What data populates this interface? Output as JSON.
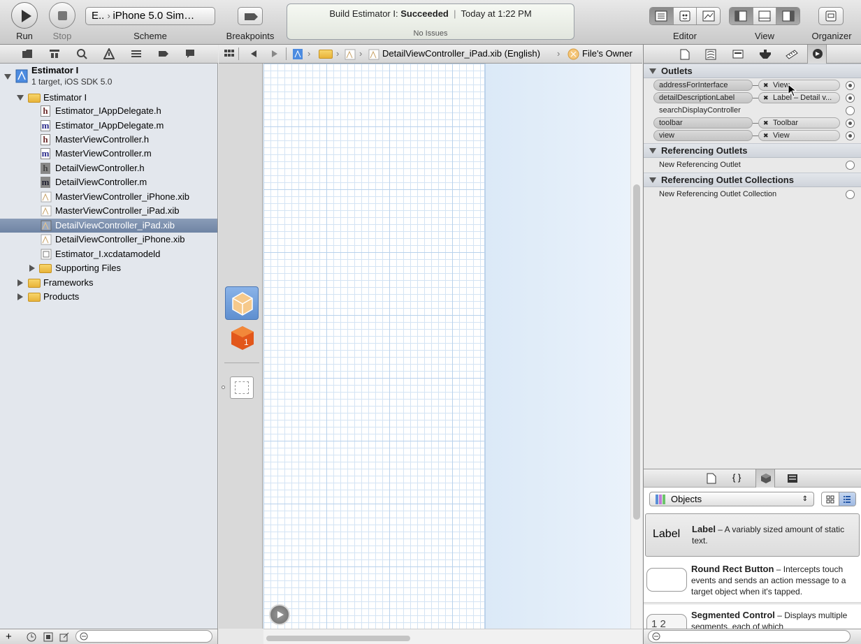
{
  "toolbar": {
    "run_label": "Run",
    "stop_label": "Stop",
    "scheme_label": "Scheme",
    "scheme_target": "E..",
    "scheme_destination": "iPhone 5.0 Sim…",
    "breakpoints_label": "Breakpoints",
    "editor_label": "Editor",
    "view_label": "View",
    "organizer_label": "Organizer"
  },
  "activity": {
    "build_prefix": "Build Estimator I:",
    "build_status": "Succeeded",
    "time": "Today at 1:22 PM",
    "issues": "No Issues"
  },
  "navigator": {
    "project": {
      "name": "Estimator I",
      "subtitle": "1 target, iOS SDK 5.0"
    },
    "items": [
      {
        "label": "Estimator I",
        "kind": "folder"
      },
      {
        "label": "Estimator_IAppDelegate.h",
        "kind": "header"
      },
      {
        "label": "Estimator_IAppDelegate.m",
        "kind": "impl"
      },
      {
        "label": "MasterViewController.h",
        "kind": "header"
      },
      {
        "label": "MasterViewController.m",
        "kind": "impl"
      },
      {
        "label": "DetailViewController.h",
        "kind": "header"
      },
      {
        "label": "DetailViewController.m",
        "kind": "impl"
      },
      {
        "label": "MasterViewController_iPhone.xib",
        "kind": "xib"
      },
      {
        "label": "MasterViewController_iPad.xib",
        "kind": "xib"
      },
      {
        "label": "DetailViewController_iPad.xib",
        "kind": "xib",
        "selected": true
      },
      {
        "label": "DetailViewController_iPhone.xib",
        "kind": "xib"
      },
      {
        "label": "Estimator_I.xcdatamodeld",
        "kind": "model"
      },
      {
        "label": "Supporting Files",
        "kind": "folder"
      },
      {
        "label": "Frameworks",
        "kind": "folder"
      },
      {
        "label": "Products",
        "kind": "folder"
      }
    ]
  },
  "jumpbar": {
    "file": "DetailViewController_iPad.xib (English)",
    "object": "File's Owner"
  },
  "connections": {
    "outlets_title": "Outlets",
    "outlets": [
      {
        "name": "addressForInterface",
        "target": "View",
        "connected": true
      },
      {
        "name": "detailDescriptionLabel",
        "target": "Label – Detail v...",
        "connected": true
      },
      {
        "name": "searchDisplayController",
        "target": "",
        "connected": false
      },
      {
        "name": "toolbar",
        "target": "Toolbar",
        "connected": true
      },
      {
        "name": "view",
        "target": "View",
        "connected": true
      }
    ],
    "referencing_title": "Referencing Outlets",
    "referencing_item": "New Referencing Outlet",
    "collections_title": "Referencing Outlet Collections",
    "collections_item": "New Referencing Outlet Collection"
  },
  "library": {
    "selector": "Objects",
    "items": [
      {
        "icon_text": "Label",
        "title": "Label",
        "desc": " – A variably sized amount of static text."
      },
      {
        "icon_text": "",
        "title": "Round Rect Button",
        "desc": " – Intercepts touch events and sends an action message to a target object when it's tapped."
      },
      {
        "icon_text": "1 2",
        "title": "Segmented Control",
        "desc": " – Displays multiple segments, each of which"
      }
    ]
  },
  "colors": {
    "selection": "#7a8eac",
    "navigator_bg": "#e3e7ed",
    "canvas_view": "#e3eefa"
  }
}
